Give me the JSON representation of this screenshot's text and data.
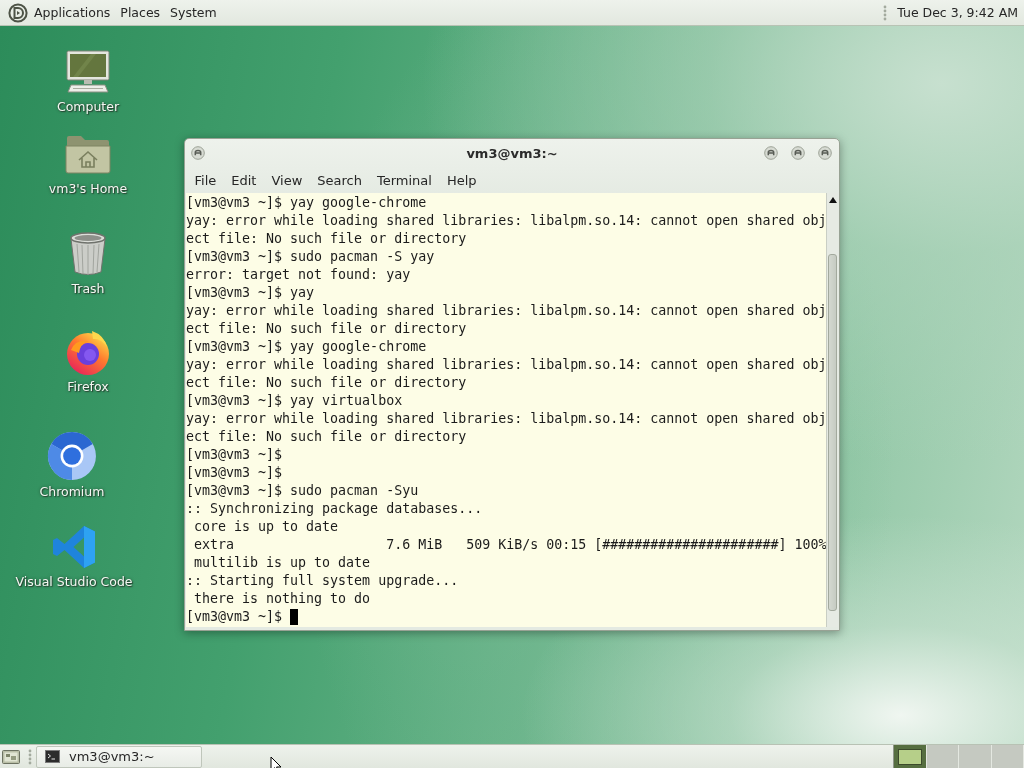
{
  "top_panel": {
    "menus": [
      "Applications",
      "Places",
      "System"
    ],
    "clock": "Tue Dec 3, 9:42 AM"
  },
  "desktop_icons": [
    {
      "label": "Computer"
    },
    {
      "label": "vm3's Home"
    },
    {
      "label": "Trash"
    },
    {
      "label": "Firefox"
    },
    {
      "label": "Chromium"
    },
    {
      "label": "Visual Studio Code"
    }
  ],
  "terminal_window": {
    "title": "vm3@vm3:~",
    "menus": [
      "File",
      "Edit",
      "View",
      "Search",
      "Terminal",
      "Help"
    ],
    "lines": [
      "[vm3@vm3 ~]$ yay google-chrome",
      "yay: error while loading shared libraries: libalpm.so.14: cannot open shared obj",
      "ect file: No such file or directory",
      "[vm3@vm3 ~]$ sudo pacman -S yay",
      "error: target not found: yay",
      "[vm3@vm3 ~]$ yay",
      "yay: error while loading shared libraries: libalpm.so.14: cannot open shared obj",
      "ect file: No such file or directory",
      "[vm3@vm3 ~]$ yay google-chrome",
      "yay: error while loading shared libraries: libalpm.so.14: cannot open shared obj",
      "ect file: No such file or directory",
      "[vm3@vm3 ~]$ yay virtualbox",
      "yay: error while loading shared libraries: libalpm.so.14: cannot open shared obj",
      "ect file: No such file or directory",
      "[vm3@vm3 ~]$",
      "[vm3@vm3 ~]$",
      "[vm3@vm3 ~]$ sudo pacman -Syu",
      ":: Synchronizing package databases...",
      " core is up to date",
      " extra                   7.6 MiB   509 KiB/s 00:15 [######################] 100%",
      " multilib is up to date",
      ":: Starting full system upgrade...",
      " there is nothing to do",
      "[vm3@vm3 ~]$"
    ],
    "cursor": true
  },
  "taskbar": {
    "tasks": [
      {
        "label": "vm3@vm3:~"
      }
    ],
    "workspaces": [
      {
        "selected": true
      },
      {
        "selected": false
      },
      {
        "selected": false
      },
      {
        "selected": false
      }
    ]
  }
}
